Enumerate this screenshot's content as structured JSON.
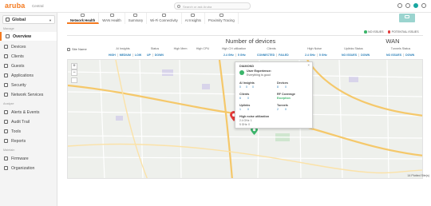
{
  "app": {
    "logo": "aruba",
    "subtitle": "Central",
    "search_placeholder": "Search or ask Aruba"
  },
  "top_icons": [
    "message-icon",
    "help-icon",
    "settings-icon",
    "user-icon"
  ],
  "sidebar": {
    "scope": "Global",
    "sections": [
      {
        "label": "Manage",
        "items": [
          {
            "label": "Overview",
            "icon": "overview-icon",
            "active": true
          },
          {
            "label": "Devices",
            "icon": "devices-icon"
          },
          {
            "label": "Clients",
            "icon": "clients-icon"
          },
          {
            "label": "Guests",
            "icon": "guests-icon"
          },
          {
            "label": "Applications",
            "icon": "applications-icon"
          },
          {
            "label": "Security",
            "icon": "security-icon"
          },
          {
            "label": "Network Services",
            "icon": "network-services-icon"
          }
        ]
      },
      {
        "label": "Analyze",
        "items": [
          {
            "label": "Alerts & Events",
            "icon": "alert-icon"
          },
          {
            "label": "Audit Trail",
            "icon": "audit-icon"
          },
          {
            "label": "Tools",
            "icon": "tools-icon"
          },
          {
            "label": "Reports",
            "icon": "reports-icon"
          }
        ]
      },
      {
        "label": "Maintain",
        "items": [
          {
            "label": "Firmware",
            "icon": "firmware-icon"
          },
          {
            "label": "Organization",
            "icon": "organization-icon"
          }
        ]
      }
    ]
  },
  "tabs": [
    {
      "label": "Network Health",
      "active": true
    },
    {
      "label": "WAN Health"
    },
    {
      "label": "Summary"
    },
    {
      "label": "Wi-Fi Connectivity"
    },
    {
      "label": "AI Insights"
    },
    {
      "label": "Proximity Tracing"
    }
  ],
  "legend": {
    "no_issues": "NO ISSUES",
    "potential_issues": "POTENTIAL ISSUES",
    "colors": {
      "no_issues": "#3bb56a",
      "potential_issues": "#e23b3b"
    }
  },
  "summary": {
    "site_name_label": "Site Name",
    "number_of_devices": "Number of devices",
    "wan": "WAN",
    "columns": [
      {
        "label": "AI Insights",
        "values": [
          "HIGH",
          "MEDIUM",
          "LOW"
        ]
      },
      {
        "label": "Status",
        "values": [
          "UP",
          "DOWN"
        ]
      },
      {
        "label": "High Mem",
        "values": []
      },
      {
        "label": "High CPU",
        "values": []
      },
      {
        "label": "High CH utilization",
        "values": [
          "2.4 GHz",
          "5 GHz"
        ]
      },
      {
        "label": "Clients",
        "values": [
          "CONNECTED",
          "FAILED"
        ]
      },
      {
        "label": "High Noise",
        "values": [
          "2.4 GHz",
          "5 GHz"
        ]
      },
      {
        "label": "Uplinks Status",
        "values": [
          "NO ISSUES",
          "DOWN"
        ]
      },
      {
        "label": "Tunnels Status",
        "values": [
          "NO ISSUES",
          "DOWN"
        ]
      }
    ]
  },
  "map": {
    "zoom_in": "+",
    "zoom_out": "−",
    "site_count": "14 Plotted Site(s)",
    "street_labels": [
      "Lakeland Dr",
      "Amerton Ave",
      "E Duane Ave",
      "Hollenbeck Ave",
      "Fremont Ave",
      "Kifer Rd",
      "Lawrence Expy"
    ]
  },
  "popup": {
    "site": "DIAMOND",
    "ux_title": "User Experience:",
    "ux_desc": "Everything is good",
    "ai_insights": {
      "label": "AI Insights",
      "v1": "0",
      "v2": "0",
      "v3": "0"
    },
    "devices": {
      "label": "Devices",
      "v1": "8",
      "v2": "0"
    },
    "clients": {
      "label": "Clients",
      "v1": "6",
      "v2": "0"
    },
    "rf_coverage": {
      "label": "RF Coverage",
      "value": "Exception"
    },
    "uplinks": {
      "label": "Uplinks",
      "v1": "1",
      "v2": "0"
    },
    "tunnels": {
      "label": "Tunnels",
      "v1": "2",
      "v2": "0"
    },
    "noise": {
      "label": "High noise utilization",
      "l1": "2.4 GHz: 1",
      "l2": "5 GHz: 0"
    }
  }
}
